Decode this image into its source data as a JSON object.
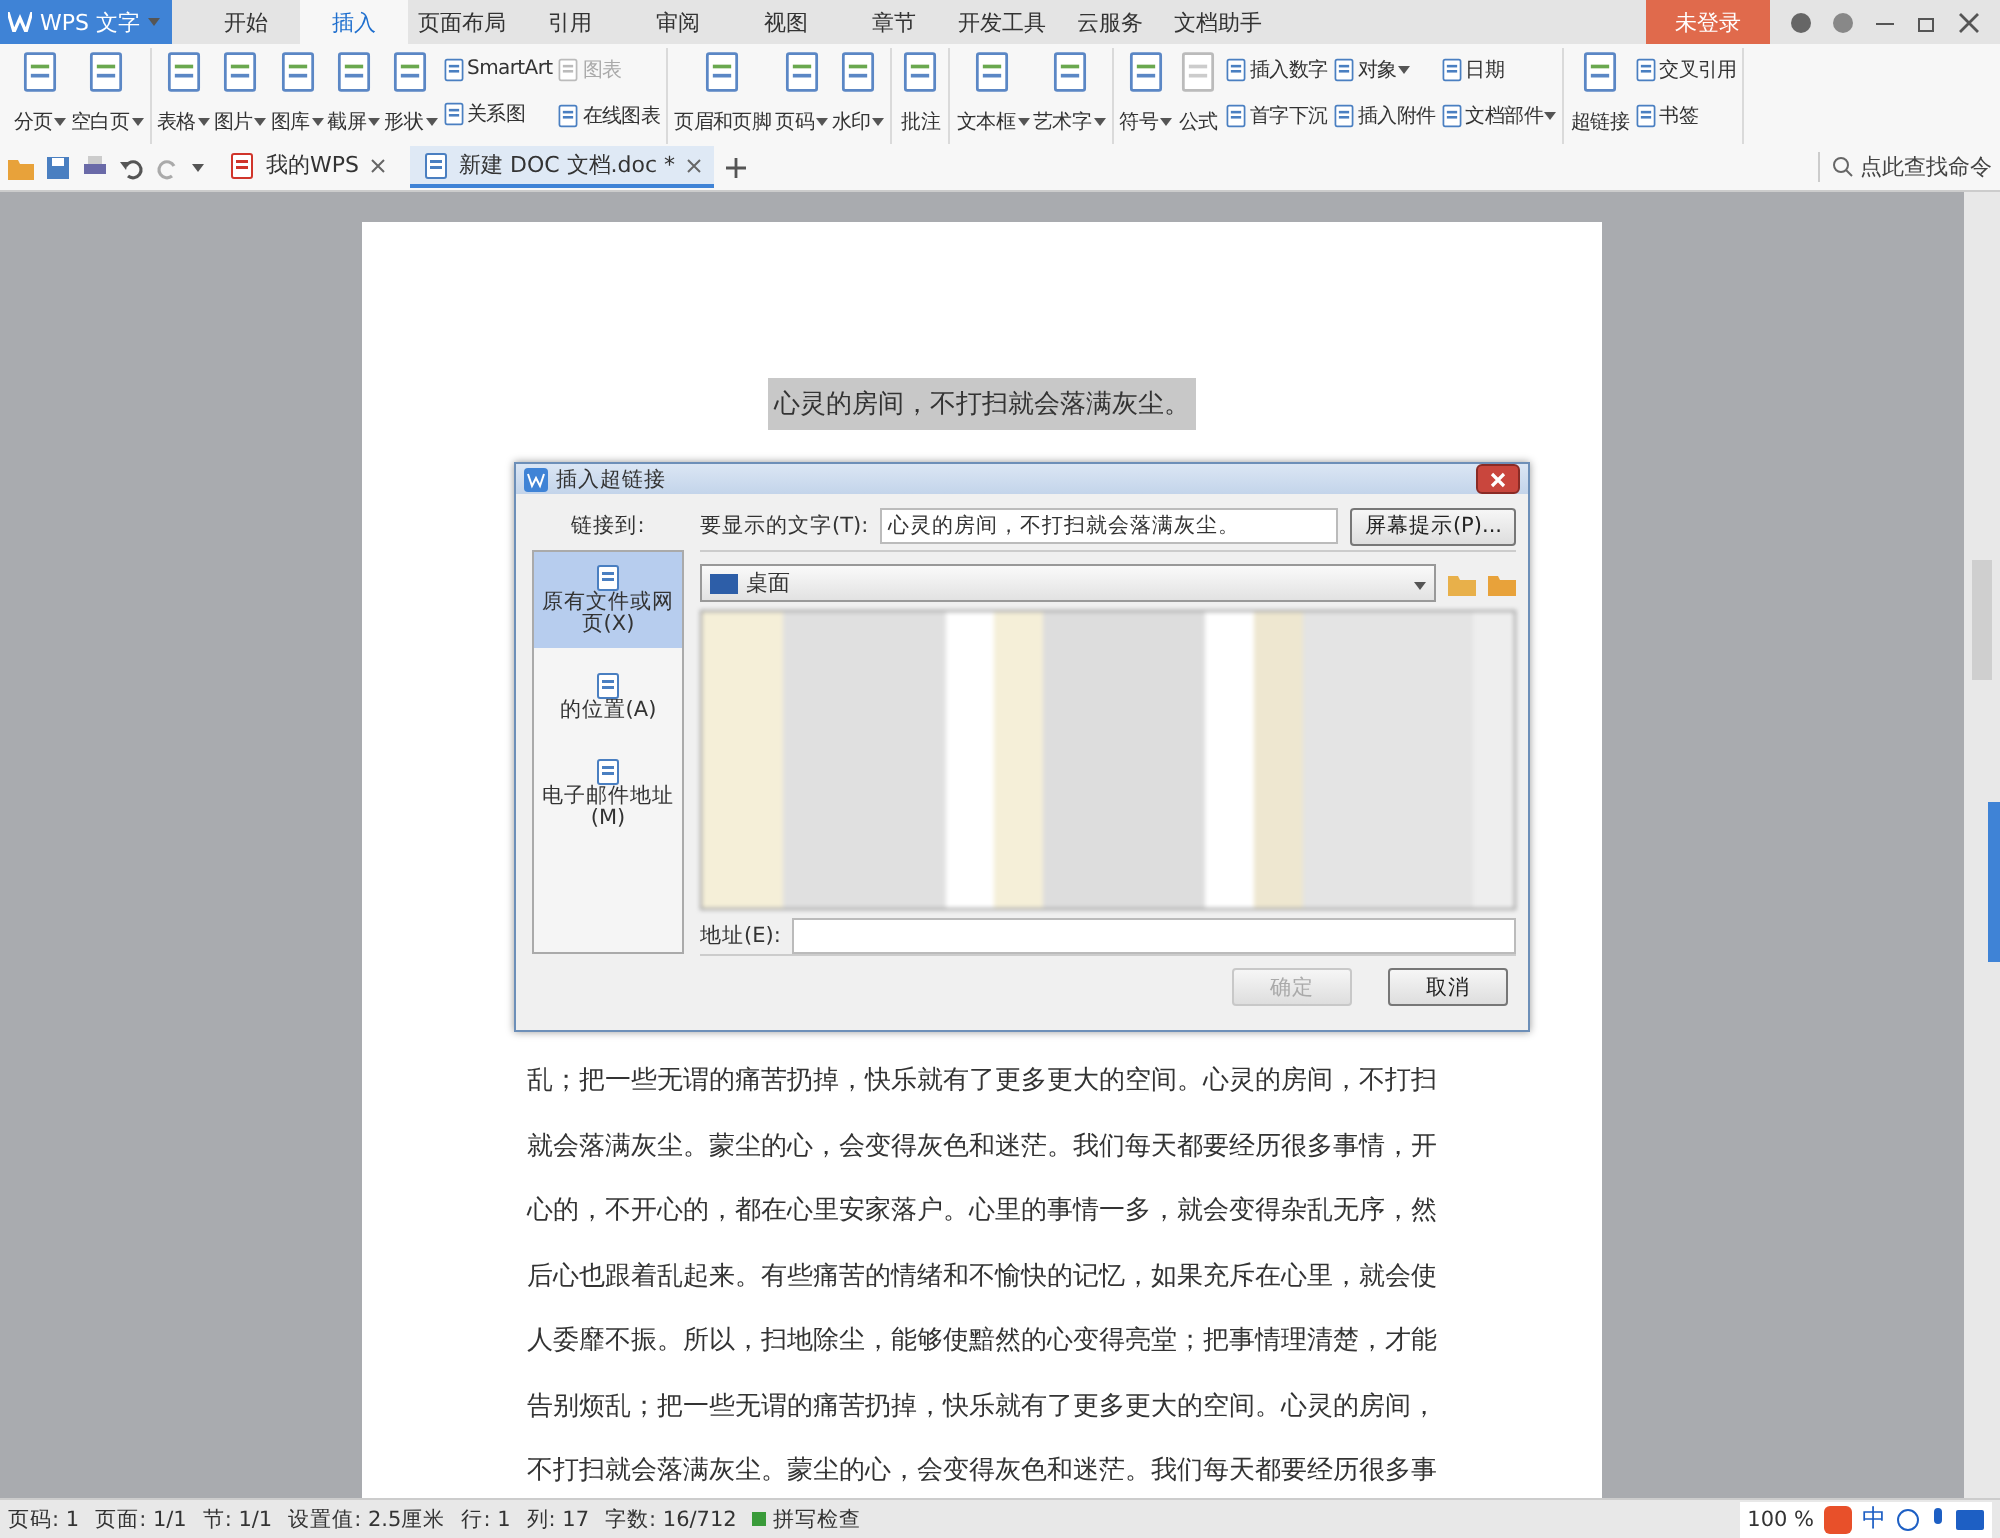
{
  "app": {
    "name": "WPS 文字",
    "login": "未登录"
  },
  "menu_tabs": [
    {
      "label": "开始",
      "selected": false
    },
    {
      "label": "插入",
      "selected": true
    },
    {
      "label": "页面布局",
      "selected": false
    },
    {
      "label": "引用",
      "selected": false
    },
    {
      "label": "审阅",
      "selected": false
    },
    {
      "label": "视图",
      "selected": false
    },
    {
      "label": "章节",
      "selected": false
    },
    {
      "label": "开发工具",
      "selected": false
    },
    {
      "label": "云服务",
      "selected": false
    },
    {
      "label": "文档助手",
      "selected": false
    }
  ],
  "ribbon": [
    {
      "items": [
        {
          "kind": "large",
          "label": "分页",
          "dropdown": true
        },
        {
          "kind": "large",
          "label": "空白页",
          "dropdown": true
        }
      ]
    },
    {
      "items": [
        {
          "kind": "large",
          "label": "表格",
          "dropdown": true
        },
        {
          "kind": "large",
          "label": "图片",
          "dropdown": true
        },
        {
          "kind": "large",
          "label": "图库",
          "dropdown": true
        },
        {
          "kind": "large",
          "label": "截屏",
          "dropdown": true
        },
        {
          "kind": "large",
          "label": "形状",
          "dropdown": true
        },
        {
          "kind": "stack",
          "entries": [
            {
              "label": "SmartArt",
              "disabled": false,
              "dropdown": false
            },
            {
              "label": "关系图",
              "disabled": false,
              "dropdown": false
            }
          ]
        },
        {
          "kind": "stack",
          "entries": [
            {
              "label": "图表",
              "disabled": true,
              "dropdown": false
            },
            {
              "label": "在线图表",
              "disabled": false,
              "dropdown": false
            }
          ]
        }
      ]
    },
    {
      "items": [
        {
          "kind": "large",
          "label": "页眉和页脚",
          "dropdown": false
        },
        {
          "kind": "large",
          "label": "页码",
          "dropdown": true
        },
        {
          "kind": "large",
          "label": "水印",
          "dropdown": true
        }
      ]
    },
    {
      "items": [
        {
          "kind": "large",
          "label": "批注",
          "dropdown": false
        }
      ]
    },
    {
      "items": [
        {
          "kind": "large",
          "label": "文本框",
          "dropdown": true
        },
        {
          "kind": "large",
          "label": "艺术字",
          "dropdown": true
        }
      ]
    },
    {
      "items": [
        {
          "kind": "large",
          "label": "符号",
          "dropdown": true
        },
        {
          "kind": "large",
          "label": "公式",
          "dropdown": false,
          "disabled": true
        },
        {
          "kind": "stack",
          "entries": [
            {
              "label": "插入数字",
              "disabled": false,
              "dropdown": false
            },
            {
              "label": "首字下沉",
              "disabled": false,
              "dropdown": false
            }
          ]
        },
        {
          "kind": "stack",
          "entries": [
            {
              "label": "对象",
              "disabled": false,
              "dropdown": true
            },
            {
              "label": "插入附件",
              "disabled": false,
              "dropdown": false
            }
          ]
        },
        {
          "kind": "stack",
          "entries": [
            {
              "label": "日期",
              "disabled": false,
              "dropdown": false
            },
            {
              "label": "文档部件",
              "disabled": false,
              "dropdown": true
            }
          ]
        }
      ]
    },
    {
      "items": [
        {
          "kind": "large",
          "label": "超链接",
          "dropdown": false
        },
        {
          "kind": "stack",
          "entries": [
            {
              "label": "交叉引用",
              "disabled": false,
              "dropdown": false
            },
            {
              "label": "书签",
              "disabled": false,
              "dropdown": false
            }
          ]
        }
      ]
    }
  ],
  "doc_tabs": [
    {
      "label": "我的WPS",
      "selected": false
    },
    {
      "label": "新建 DOC 文档.doc *",
      "selected": true
    }
  ],
  "command_search": {
    "placeholder": "点此查找命令"
  },
  "document": {
    "title": "心灵的房间，不打扫就会落满灰尘。",
    "lines": [
      "乱；把一些无谓的痛苦扔掉，快乐就有了更多更大的空间。心灵的房间，不打扫",
      "就会落满灰尘。蒙尘的心，会变得灰色和迷茫。我们每天都要经历很多事情，开",
      "心的，不开心的，都在心里安家落户。心里的事情一多，就会变得杂乱无序，然",
      "后心也跟着乱起来。有些痛苦的情绪和不愉快的记忆，如果充斥在心里，就会使",
      "人委靡不振。所以，扫地除尘，能够使黯然的心变得亮堂；把事情理清楚，才能",
      "告别烦乱；把一些无谓的痛苦扔掉，快乐就有了更多更大的空间。心灵的房间，",
      "不打扫就会落满灰尘。蒙尘的心，会变得灰色和迷茫。我们每天都要经历很多事"
    ]
  },
  "dialog": {
    "title": "插入超链接",
    "link_to_label": "链接到:",
    "display_text_label": "要显示的文字(T):",
    "display_text_value": "心灵的房间，不打扫就会落满灰尘。",
    "screen_tip_button": "屏幕提示(P)...",
    "link_targets": [
      {
        "label": "原有文件或网页(X)",
        "selected": true
      },
      {
        "label": "的位置(A)",
        "selected": false
      },
      {
        "label": "电子邮件地址(M)",
        "selected": false
      }
    ],
    "folder": "桌面",
    "address_label": "地址(E):",
    "ok_button": {
      "label": "确定",
      "disabled": true
    },
    "cancel_button": "取消"
  },
  "status_bar": {
    "items": [
      "页码: 1",
      "页面: 1/1",
      "节: 1/1",
      "设置值: 2.5厘米",
      "行: 1",
      "列: 17",
      "字数: 16/712"
    ],
    "spell_check": "拼写检查",
    "zoom": "100 %",
    "ime": "中"
  }
}
